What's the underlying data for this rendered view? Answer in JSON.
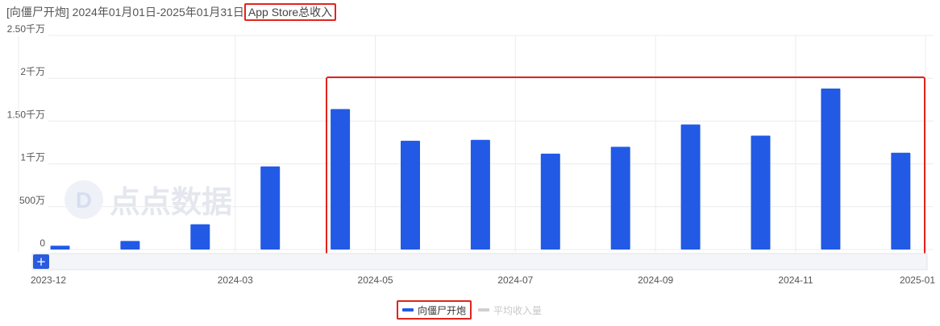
{
  "header": {
    "app_name": "[向僵尸开炮]",
    "date_range": "2024年01月01日-2025年01月31日",
    "metric": "App Store总收入"
  },
  "watermark": {
    "text": "点点数据",
    "logo_letter": "D"
  },
  "zoom_control": {
    "label": "+"
  },
  "colors": {
    "bar": "#225ae6",
    "highlight": "#e0241b",
    "grid": "#ececec",
    "avg": "#d0d0d0"
  },
  "legend": {
    "items": [
      {
        "label": "向僵尸开炮",
        "color": "#225ae6",
        "active": true
      },
      {
        "label": "平均收入量",
        "color": "#d0d0d0",
        "active": false
      }
    ]
  },
  "chart_data": {
    "type": "bar",
    "categories": [
      "2023-12",
      "2024-01",
      "2024-02",
      "2024-03",
      "2024-04",
      "2024-05",
      "2024-06",
      "2024-07",
      "2024-08",
      "2024-09",
      "2024-10",
      "2024-11",
      "2024-12"
    ],
    "series": [
      {
        "name": "向僵尸开炮",
        "values": [
          450000,
          1000000,
          2950000,
          9700000,
          16400000,
          12700000,
          12800000,
          11200000,
          12000000,
          14600000,
          13300000,
          18800000,
          11300000
        ]
      }
    ],
    "x_tick_labels": [
      "2023-12",
      "2024-03",
      "2024-05",
      "2024-07",
      "2024-09",
      "2024-11",
      "2025-01"
    ],
    "y_tick_labels": [
      "0",
      "500万",
      "1千万",
      "1.50千万",
      "2千万",
      "2.50千万"
    ],
    "y_ticks": [
      0,
      5000000,
      10000000,
      15000000,
      20000000,
      25000000
    ],
    "ylim": [
      0,
      25000000
    ],
    "grid": true,
    "legend_position": "bottom"
  }
}
